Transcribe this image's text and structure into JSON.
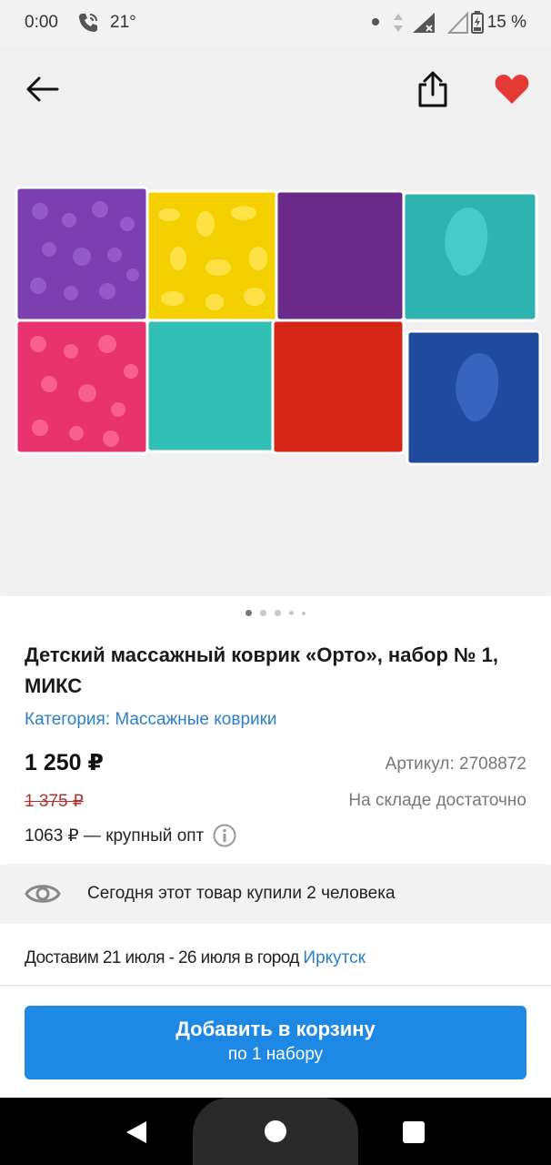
{
  "status_bar": {
    "time": "0:00",
    "temperature": "21°",
    "battery": "15 %"
  },
  "header": {
    "back_icon": "arrow-left-icon",
    "share_icon": "share-icon",
    "favorite_icon": "heart-icon",
    "favorite_color": "#e53935"
  },
  "gallery": {
    "image_alt": "",
    "dots_count": 5,
    "active_index": 0,
    "tiles": [
      {
        "color": "#7b3fb0"
      },
      {
        "color": "#f5d000"
      },
      {
        "color": "#6a2a8a"
      },
      {
        "color": "#2fb3b0"
      },
      {
        "color": "#e8336f"
      },
      {
        "color": "#33c0b4"
      },
      {
        "color": "#d62416"
      },
      {
        "color": "#1f4a9e"
      }
    ]
  },
  "product": {
    "title": "Детский массажный коврик «Орто», набор № 1, МИКС",
    "category": "Категория: Массажные коврики",
    "price": "1 250 ₽",
    "article": "Артикул: 2708872",
    "old_price": "1 375 ₽",
    "stock": "На складе достаточно",
    "wholesale": "1063 ₽ — крупный опт"
  },
  "viewers": {
    "text": "Сегодня этот товар купили 2 человека"
  },
  "delivery": {
    "text": "Доставим 21 июля - 26 июля в город ",
    "city": "Иркутск"
  },
  "cart_button": {
    "label": "Добавить в корзину",
    "sublabel": "по 1 набору",
    "color": "#1e88e5"
  },
  "navbar": {
    "back": "nav-back-icon",
    "home": "nav-home-icon",
    "recent": "nav-recent-icon"
  }
}
